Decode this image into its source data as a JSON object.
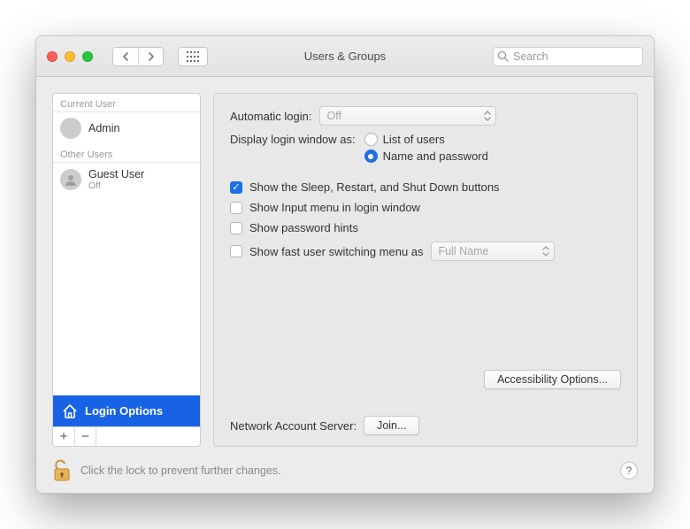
{
  "window": {
    "title": "Users & Groups",
    "search_placeholder": "Search"
  },
  "sidebar": {
    "current_user_heading": "Current User",
    "other_users_heading": "Other Users",
    "current_user": {
      "name": "Admin",
      "status": ""
    },
    "other_users": [
      {
        "name": "Guest User",
        "status": "Off"
      }
    ],
    "login_options_label": "Login Options"
  },
  "main": {
    "automatic_login_label": "Automatic login:",
    "automatic_login_value": "Off",
    "display_login_label": "Display login window as:",
    "radio_list_of_users": "List of users",
    "radio_name_and_password": "Name and password",
    "display_login_selected": "name_and_password",
    "checkboxes": {
      "sleep_restart": {
        "label": "Show the Sleep, Restart, and Shut Down buttons",
        "checked": true
      },
      "input_menu": {
        "label": "Show Input menu in login window",
        "checked": false
      },
      "password_hints": {
        "label": "Show password hints",
        "checked": false
      },
      "fast_user_switch": {
        "label": "Show fast user switching menu as",
        "checked": false,
        "select_value": "Full Name"
      }
    },
    "accessibility_button": "Accessibility Options...",
    "network_account_label": "Network Account Server:",
    "join_button": "Join..."
  },
  "footer": {
    "lock_hint": "Click the lock to prevent further changes."
  }
}
